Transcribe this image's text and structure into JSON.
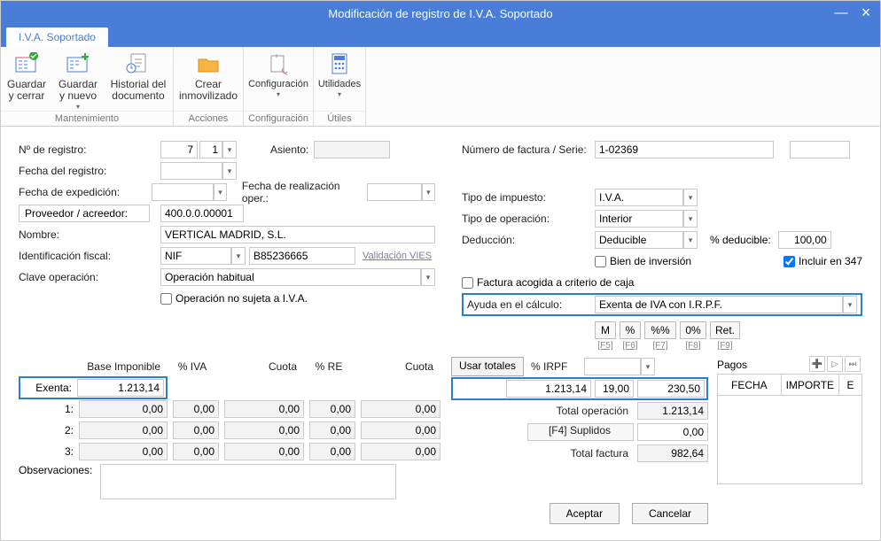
{
  "title": "Modificación de registro de I.V.A. Soportado",
  "tab": "I.V.A. Soportado",
  "ribbon": {
    "groups": [
      {
        "label": "Mantenimiento",
        "items": [
          {
            "l1": "Guardar",
            "l2": "y cerrar"
          },
          {
            "l1": "Guardar",
            "l2": "y nuevo",
            "dd": true
          },
          {
            "l1": "Historial del",
            "l2": "documento"
          }
        ]
      },
      {
        "label": "Acciones",
        "items": [
          {
            "l1": "Crear",
            "l2": "inmovilizado"
          }
        ]
      },
      {
        "label": "Configuración",
        "items": [
          {
            "l1": "Configuración",
            "l2": "",
            "dd": true
          }
        ]
      },
      {
        "label": "Útiles",
        "items": [
          {
            "l1": "Utilidades",
            "l2": "",
            "dd": true
          }
        ]
      }
    ]
  },
  "left": {
    "nregistro_lbl": "Nº de registro:",
    "nregistro": "7",
    "nregistro2": "1",
    "fecha_reg_lbl": "Fecha del registro:",
    "fecha_exp_lbl": "Fecha de expedición:",
    "fecha_real_lbl": "Fecha de realización oper.:",
    "asiento_lbl": "Asiento:",
    "prov_lbl": "Proveedor / acreedor:",
    "prov": "400.0.0.00001",
    "nombre_lbl": "Nombre:",
    "nombre": "VERTICAL MADRID, S.L.",
    "idfiscal_lbl": "Identificación fiscal:",
    "idfiscal_tipo": "NIF",
    "idfiscal_val": "B85236665",
    "vies": "Validación VIES",
    "clave_lbl": "Clave operación:",
    "clave": "Operación habitual",
    "no_sujeta": "Operación no sujeta a I.V.A."
  },
  "right": {
    "fact_lbl": "Número de factura / Serie:",
    "fact": "1-02369",
    "tipo_imp_lbl": "Tipo de impuesto:",
    "tipo_imp": "I.V.A.",
    "tipo_op_lbl": "Tipo de operación:",
    "tipo_op": "Interior",
    "ded_lbl": "Deducción:",
    "ded": "Deducible",
    "pd_lbl": "% deducible:",
    "pd": "100,00",
    "bien": "Bien de inversión",
    "inc347": "Incluir en 347",
    "fcc": "Factura acogida a criterio de caja",
    "ayuda_lbl": "Ayuda en el cálculo:",
    "ayuda": "Exenta de IVA con I.R.P.F.",
    "hb": [
      "M",
      "%",
      "%%",
      "0%",
      "Ret."
    ],
    "hk": [
      "[F5]",
      "[F6]",
      "[F7]",
      "[F8]",
      "[F9]"
    ]
  },
  "grid": {
    "headers": {
      "base": "Base Imponible",
      "iva": "% IVA",
      "cuota": "Cuota",
      "re": "% RE",
      "cuota2": "Cuota",
      "usar": "Usar totales",
      "irpf": "% IRPF",
      "pagos": "Pagos"
    },
    "exenta_lbl": "Exenta:",
    "exenta": "1.213,14",
    "rows": [
      {
        "lbl": "1:",
        "base": "0,00",
        "iva": "0,00",
        "cuota": "0,00",
        "re": "0,00",
        "cuota2": "0,00"
      },
      {
        "lbl": "2:",
        "base": "0,00",
        "iva": "0,00",
        "cuota": "0,00",
        "re": "0,00",
        "cuota2": "0,00"
      },
      {
        "lbl": "3:",
        "base": "0,00",
        "iva": "0,00",
        "cuota": "0,00",
        "re": "0,00",
        "cuota2": "0,00"
      }
    ],
    "irpf_base": "1.213,14",
    "irpf_pct": "19,00",
    "irpf_val": "230,50",
    "tot_op_lbl": "Total operación",
    "tot_op": "1.213,14",
    "supl_lbl": "[F4] Suplidos",
    "supl": "0,00",
    "tot_fact_lbl": "Total factura",
    "tot_fact": "982,64",
    "obs_lbl": "Observaciones:",
    "pagos_cols": {
      "fecha": "FECHA",
      "importe": "IMPORTE",
      "e": "E"
    }
  },
  "btns": {
    "ok": "Aceptar",
    "cancel": "Cancelar"
  }
}
